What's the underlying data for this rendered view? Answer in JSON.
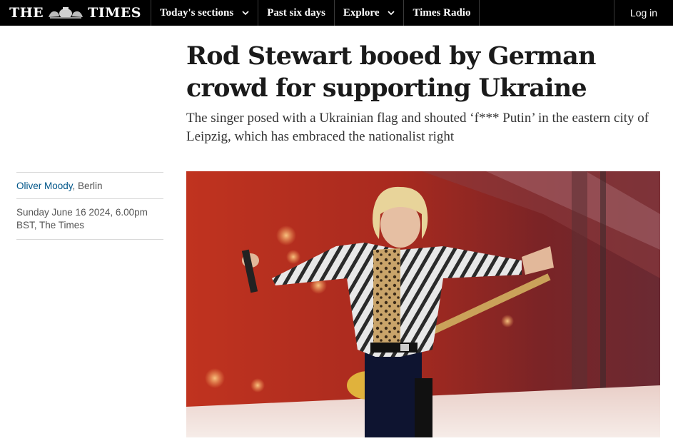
{
  "nav": {
    "logo_left": "THE",
    "logo_right": "TIMES",
    "items": [
      {
        "label": "Today's sections",
        "has_dropdown": true
      },
      {
        "label": "Past six days",
        "has_dropdown": false
      },
      {
        "label": "Explore",
        "has_dropdown": true
      },
      {
        "label": "Times Radio",
        "has_dropdown": false
      }
    ],
    "login_label": "Log in"
  },
  "article": {
    "headline": "Rod Stewart booed by German crowd for supporting Ukraine",
    "standfirst": "The singer posed with a Ukrainian flag and shouted ‘f*** Putin’ in the eastern city of Leipzig, which has embraced the nationalist right",
    "byline": {
      "author": "Oliver Moody",
      "location_suffix": ", Berlin",
      "date": "Sunday June 16 2024, 6.00pm BST, The Times"
    }
  },
  "colors": {
    "nav_bg": "#000000",
    "author_link": "#005689",
    "headline": "#1a1a1a"
  }
}
